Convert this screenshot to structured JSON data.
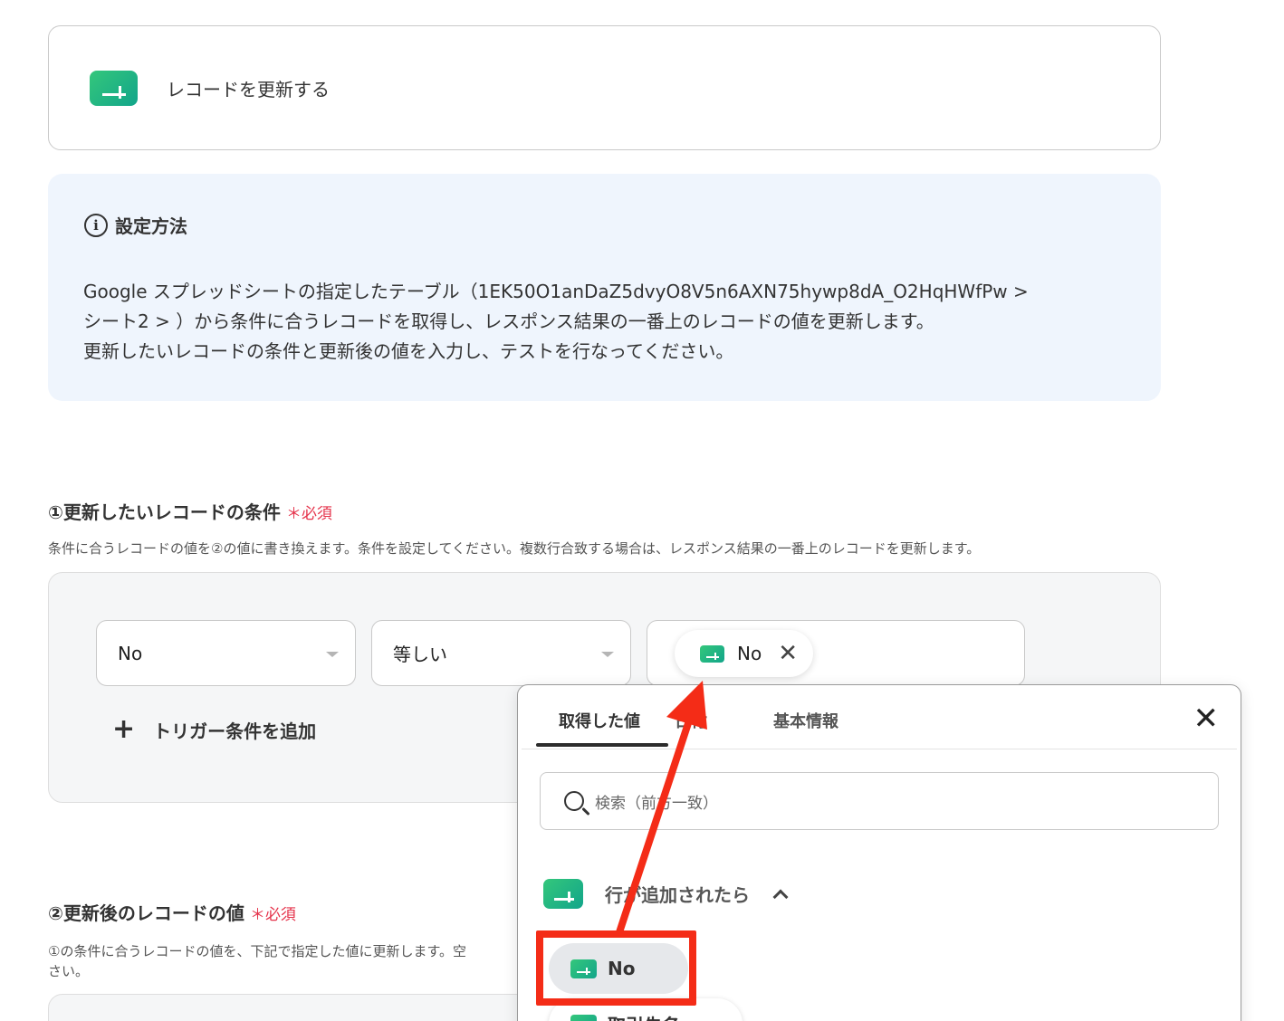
{
  "action_card": {
    "icon": "google-sheets-icon",
    "title": "レコードを更新する"
  },
  "info": {
    "icon": "info-icon",
    "title": "設定方法",
    "lines": [
      "Google スプレッドシートの指定したテーブル（1EK50O1anDaZ5dvyO8V5n6AXN75hywp8dA_O2HqHWfPw >",
      "シート2 > ）から条件に合うレコードを取得し、レスポンス結果の一番上のレコードの値を更新します。",
      "更新したいレコードの条件と更新後の値を入力し、テストを行なってください。"
    ]
  },
  "section1": {
    "title": "①更新したいレコードの条件",
    "required_mark": "＊",
    "required_label": "必須",
    "description": "条件に合うレコードの値を②の値に書き換えます。条件を設定してください。複数行合致する場合は、レスポンス結果の一番上のレコードを更新します。",
    "field_select": "No",
    "operator_select": "等しい",
    "value_chip": "No",
    "add_trigger": "トリガー条件を追加"
  },
  "section2": {
    "title": "②更新後のレコードの値",
    "required_mark": "＊",
    "required_label": "必須",
    "description_line1": "①の条件に合うレコードの値を、下記で指定した値に更新します。空",
    "description_line2": "さい。"
  },
  "popup": {
    "tabs": [
      "取得した値",
      "日付",
      "基本情報"
    ],
    "active_tab": 0,
    "search_placeholder": "検索（前方一致）",
    "group_title": "行が追加されたら",
    "items": [
      "No",
      "取引先名"
    ]
  },
  "colors": {
    "accent_green": "#1fb585",
    "required": "#e5334b",
    "highlight_red": "#f42c17"
  }
}
